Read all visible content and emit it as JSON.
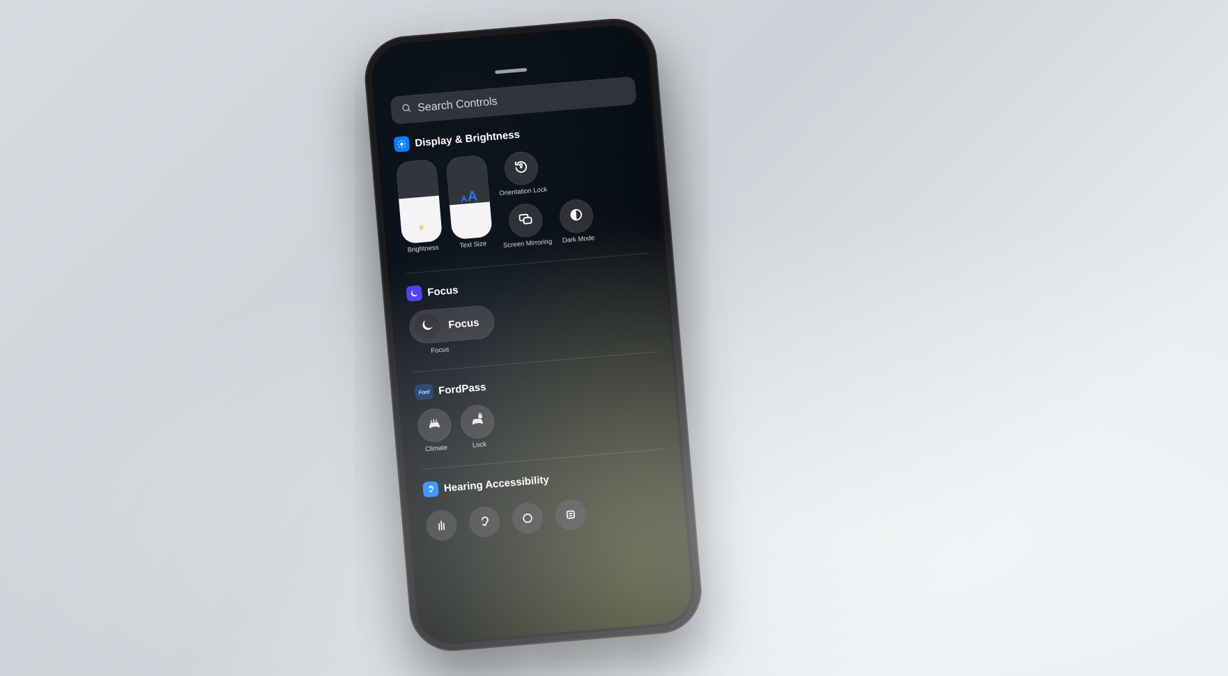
{
  "search": {
    "placeholder": "Search Controls"
  },
  "sections": {
    "display": {
      "title": "Display & Brightness",
      "brightness": {
        "label": "Brightness",
        "level_pct": 55
      },
      "text_size": {
        "label": "Text Size",
        "level_pct": 42
      },
      "orientation": {
        "label": "Orientation Lock"
      },
      "screen_mirroring": {
        "label": "Screen Mirroring"
      },
      "dark_mode": {
        "label": "Dark Mode"
      }
    },
    "focus": {
      "title": "Focus",
      "control_label": "Focus",
      "caption": "Focus"
    },
    "fordpass": {
      "title": "FordPass",
      "badge_text": "Ford",
      "climate": {
        "label": "Climate"
      },
      "lock": {
        "label": "Lock"
      }
    },
    "hearing": {
      "title": "Hearing Accessibility"
    }
  },
  "icons": {
    "display_badge": "sun-icon",
    "focus_badge": "moon-icon",
    "hearing_badge": "ear-icon"
  }
}
